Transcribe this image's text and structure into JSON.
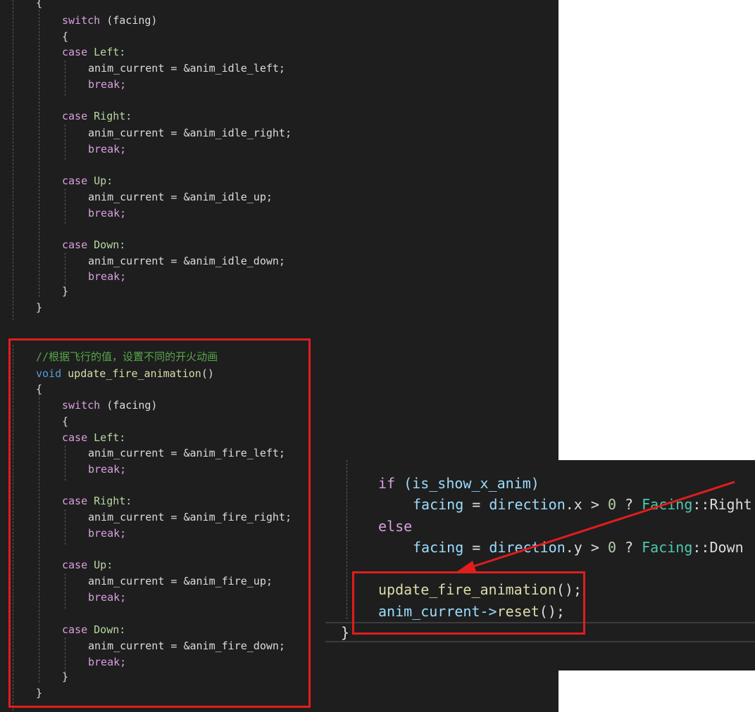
{
  "top": {
    "brace_open": "{",
    "switch_kw": "switch",
    "switch_arg": " (facing)",
    "switch_brace_open": "{",
    "cases": [
      {
        "kw": "case",
        "label": " Left:",
        "assign": "anim_current = &anim_idle_left;",
        "brk": "break;"
      },
      {
        "kw": "case",
        "label": " Right:",
        "assign": "anim_current = &anim_idle_right;",
        "brk": "break;"
      },
      {
        "kw": "case",
        "label": " Up:",
        "assign": "anim_current = &anim_idle_up;",
        "brk": "break;"
      },
      {
        "kw": "case",
        "label": " Down:",
        "assign": "anim_current = &anim_idle_down;",
        "brk": "break;"
      }
    ],
    "switch_brace_close": "}",
    "brace_close": "}"
  },
  "fire": {
    "comment": "//根据飞行的值，设置不同的开火动画",
    "void_kw": "void",
    "fn_name": " update_fire_animation",
    "parens": "()",
    "brace_open": "{",
    "switch_kw": "switch",
    "switch_arg": " (facing)",
    "switch_brace_open": "{",
    "cases": [
      {
        "kw": "case",
        "label": " Left:",
        "assign": "anim_current = &anim_fire_left;",
        "brk": "break;"
      },
      {
        "kw": "case",
        "label": " Right:",
        "assign": "anim_current = &anim_fire_right;",
        "brk": "break;"
      },
      {
        "kw": "case",
        "label": " Up:",
        "assign": "anim_current = &anim_fire_up;",
        "brk": "break;"
      },
      {
        "kw": "case",
        "label": " Down:",
        "assign": "anim_current = &anim_fire_down;",
        "brk": "break;"
      }
    ],
    "switch_brace_close": "}",
    "brace_close": "}"
  },
  "snippet": {
    "if_kw": "if",
    "if_cond": " (is_show_x_anim)",
    "line1_var": "facing",
    "line1_eq": " = ",
    "line1_dir": "direction",
    "line1_axis": ".x > ",
    "line1_num": "0",
    "line1_q": " ? ",
    "line1_type": "Facing",
    "line1_rest": "::Right",
    "else_kw": "else",
    "line2_var": "facing",
    "line2_eq": " = ",
    "line2_dir": "direction",
    "line2_axis": ".y > ",
    "line2_num": "0",
    "line2_q": " ? ",
    "line2_type": "Facing",
    "line2_rest": "::Down",
    "call_fn": "update_fire_animation",
    "call_tail": "();",
    "reset_obj": "anim_current->",
    "reset_fn": "reset",
    "reset_tail": "();",
    "close_brace": "}"
  },
  "colors": {
    "highlight_red": "#e11d1d",
    "editor_bg": "#1e1e1e"
  }
}
